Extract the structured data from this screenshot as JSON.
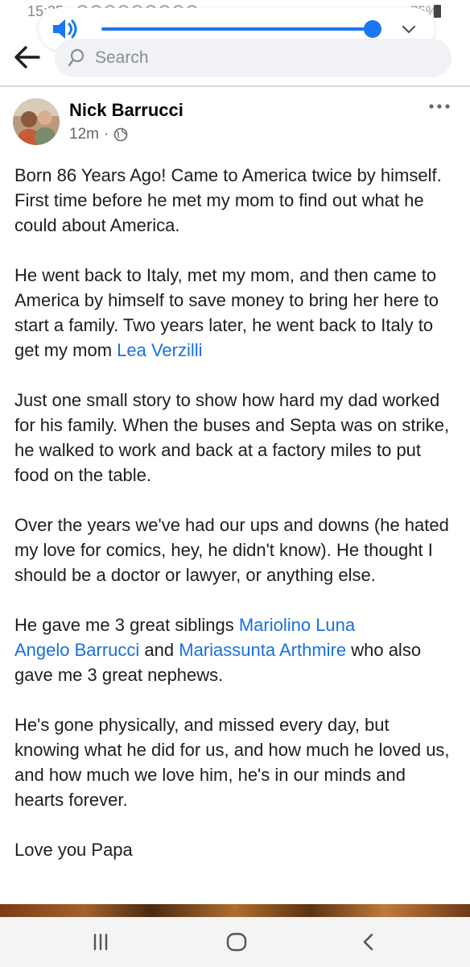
{
  "status_bar": {
    "time": "15:35",
    "battery": "75%"
  },
  "volume": {
    "level": 1.0,
    "speaker_icon": "speaker-icon",
    "expand_icon": "chevron-down-icon"
  },
  "header": {
    "back_icon": "arrow-left-icon",
    "search": {
      "placeholder": "Search",
      "value": ""
    }
  },
  "post": {
    "author": "Nick Barrucci",
    "time": "12m",
    "separator": "·",
    "privacy_icon": "globe-icon",
    "more_icon": "more-icon",
    "paragraphs": {
      "p1": "Born 86 Years Ago! Came to America twice by himself.  First time before he met my mom to find out what he could about America.",
      "p2": "He went back to Italy, met my mom, and then came to America by himself to save money to bring her here to start a family.  Two years later, he went back to Italy to get my mom ",
      "p2_mention": "Lea Verzilli",
      "p3": "Just one small story to show how hard my dad worked for his family.  When the buses and Septa was on strike, he walked to work and back at a factory miles to put food on the table.",
      "p4": "Over the years we've had our ups and downs (he hated my love for comics, hey, he didn't know).  He thought I should be a doctor or lawyer, or anything else.",
      "p5_a": "He gave me 3 great siblings ",
      "p5_mention1": "Mariolino Luna",
      "p5_mention2": "Angelo Barrucci",
      "p5_b": " and ",
      "p5_mention3": "Mariassunta Arthmire",
      "p5_c": " who also gave me 3 great nephews.",
      "p6": "He's gone physically, and missed every day, but knowing what he did for us, and how much he loved us, and how much we love him, he's in our minds and hearts forever.",
      "p7": "Love you Papa"
    }
  },
  "nav_bar": {
    "recents_icon": "recents-icon",
    "home_icon": "home-icon",
    "back_icon": "back-chevron-icon"
  },
  "colors": {
    "accent": "#1877f2",
    "mention": "#1a6fe0",
    "text": "#1c1e21",
    "muted": "#65676b",
    "search_bg": "#f0f2f5"
  }
}
